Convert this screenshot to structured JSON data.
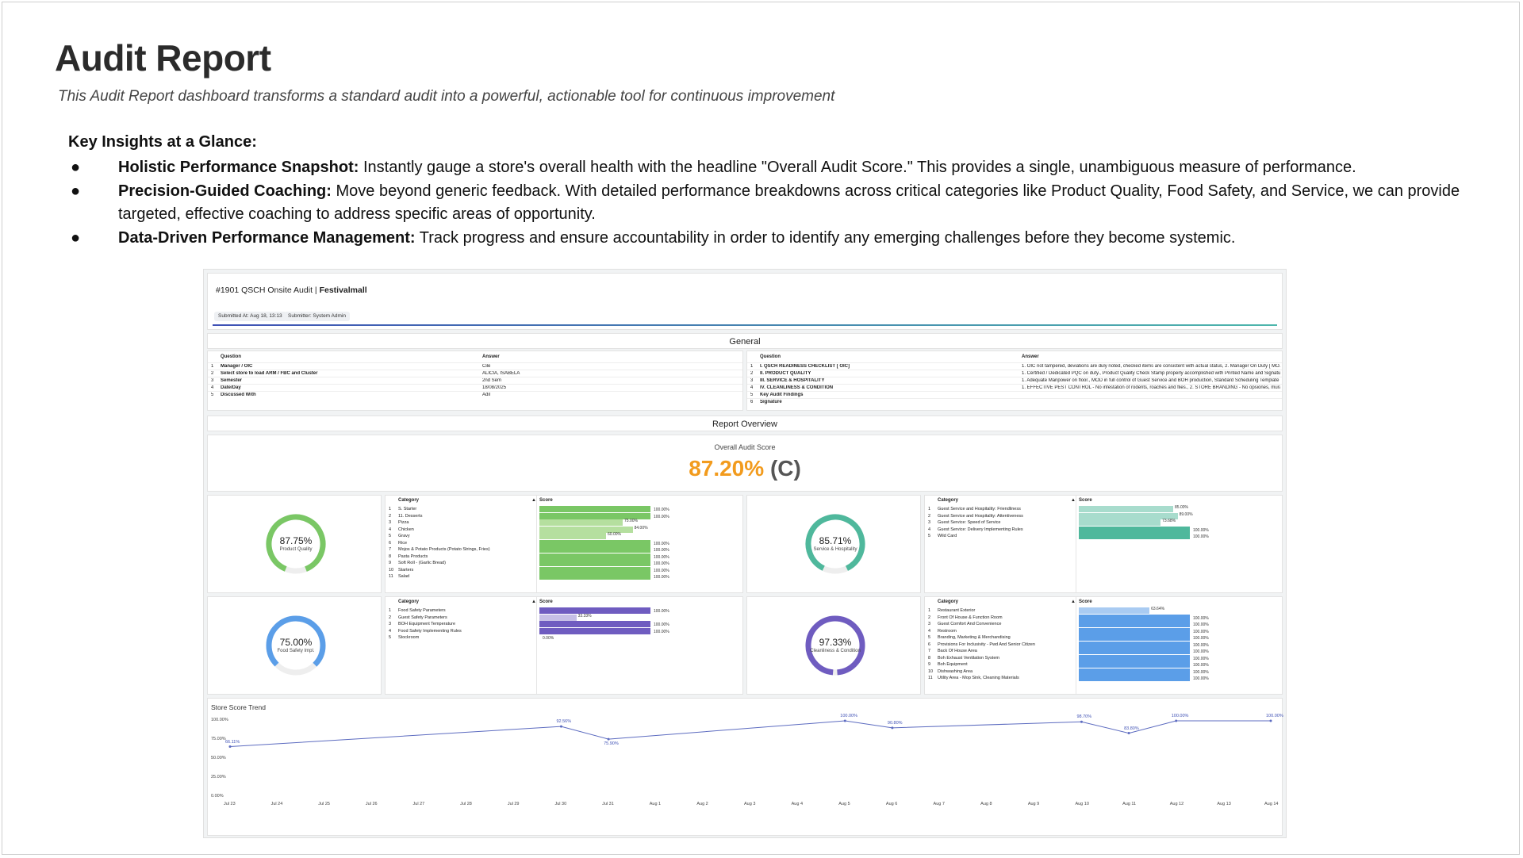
{
  "page": {
    "title": "Audit Report",
    "subtitle": "This Audit Report dashboard transforms a standard audit into a powerful, actionable tool for continuous improvement"
  },
  "insights": {
    "heading": "Key Insights at a Glance:",
    "items": [
      {
        "bold": "Holistic Performance Snapshot:",
        "text": " Instantly gauge a store's overall health with the headline \"Overall Audit Score.\" This provides a single, unambiguous measure of performance."
      },
      {
        "bold": "Precision-Guided Coaching:",
        "text": " Move beyond generic feedback. With detailed performance breakdowns across critical categories like Product Quality, Food Safety, and Service, we can provide targeted, effective coaching to address specific areas of opportunity."
      },
      {
        "bold": "Data-Driven Performance Management:",
        "text": " Track progress and ensure accountability in order to identify any emerging challenges before they become systemic."
      }
    ]
  },
  "dashboard": {
    "header_title": "#1901 QSCH Onsite Audit  |",
    "header_store": "Festivalmall",
    "submitted_at": "Submitted At: Aug 18, 13:13",
    "submitter": "Submitter: System Admin",
    "general_title": "General",
    "report_overview_title": "Report Overview",
    "general_left": {
      "col_question": "Question",
      "col_answer": "Answer",
      "rows": [
        {
          "n": "1",
          "q": "Manager / OIC",
          "a": "Cile"
        },
        {
          "n": "2",
          "q": "Select store to load ARM / FBC and Cluster",
          "a": "ALICIA, ISABELA"
        },
        {
          "n": "3",
          "q": "Semester",
          "a": "2nd Sem"
        },
        {
          "n": "4",
          "q": "Date/Day",
          "a": "18/08/2025"
        },
        {
          "n": "5",
          "q": "Discussed With",
          "a": "Adil"
        }
      ]
    },
    "general_right": {
      "col_question": "Question",
      "col_answer": "Answer",
      "rows": [
        {
          "n": "1",
          "q": "I. QSCH READINESS CHECKLIST [ OIC]",
          "a": "1. OIC not tampered, deviations are duly noted, checked items are consistent with actual status, 2. Manager On Duty [ MO..."
        },
        {
          "n": "2",
          "q": "II. PRODUCT QUALITY",
          "a": "1. Certified / Dedicated PQC on duty., Product Quality Check Stamp properly accomplished with Printed Name and Signatu..."
        },
        {
          "n": "3",
          "q": "III. SERVICE & HOSPITALITY",
          "a": "1. Adequate Manpower on floor., MOD in full control of Guest Service and BOH production, Standard Scheduling Template ..."
        },
        {
          "n": "4",
          "q": "IV. CLEANLINESS & CONDITION",
          "a": "1. EFFECTIVE PEST CONTROL - No infestation of rodents, roaches and flies., 2. STORE BRANDING - No opsiones, murals a..."
        },
        {
          "n": "5",
          "q": "Key Audit Findings",
          "a": ""
        },
        {
          "n": "6",
          "q": "Signature",
          "a": ""
        }
      ]
    },
    "overall": {
      "label": "Overall Audit Score",
      "value": "87.20%",
      "grade": "(C)"
    },
    "gauges": [
      {
        "id": "pq",
        "value": "87.75%",
        "label": "Product Quality",
        "fraction": 0.8775,
        "color": "#7ac765"
      },
      {
        "id": "sh",
        "value": "85.71%",
        "label": "Service & Hospitality",
        "fraction": 0.8571,
        "color": "#4fb89c"
      },
      {
        "id": "fs",
        "value": "75.00%",
        "label": "Food Safety Impl.",
        "fraction": 0.75,
        "color": "#5b9ee8"
      },
      {
        "id": "cc",
        "value": "97.33%",
        "label": "Cleanliness & Condition",
        "fraction": 0.9733,
        "color": "#6f5cc0"
      }
    ],
    "tables": [
      {
        "id": "pq",
        "col_category": "Category",
        "col_score": "Score",
        "color": "#7ac765",
        "light": "#b5df9f",
        "rows": [
          {
            "n": "1",
            "c": "S. Starter",
            "v": 100,
            "l": "100.00%"
          },
          {
            "n": "2",
            "c": "11. Desserts",
            "v": 100,
            "l": "100.00%"
          },
          {
            "n": "3",
            "c": "Pizza",
            "v": 75,
            "l": "75.00%"
          },
          {
            "n": "4",
            "c": "Chicken",
            "v": 84,
            "l": "84.00%"
          },
          {
            "n": "5",
            "c": "Gravy",
            "v": 60,
            "l": "60.00%"
          },
          {
            "n": "6",
            "c": "Rice",
            "v": 100,
            "l": "100.00%"
          },
          {
            "n": "7",
            "c": "Mojos & Potato Products (Potato Strings, Fries)",
            "v": 100,
            "l": "100.00%"
          },
          {
            "n": "8",
            "c": "Pasta Products",
            "v": 100,
            "l": "100.00%"
          },
          {
            "n": "9",
            "c": "Soft Roll - (Garlic Bread)",
            "v": 100,
            "l": "100.00%"
          },
          {
            "n": "10",
            "c": "Starters",
            "v": 100,
            "l": "100.00%"
          },
          {
            "n": "11",
            "c": "Salad",
            "v": 100,
            "l": "100.00%"
          }
        ]
      },
      {
        "id": "sh",
        "col_category": "Category",
        "col_score": "Score",
        "color": "#4fb89c",
        "light": "#a8dccd",
        "rows": [
          {
            "n": "1",
            "c": "Guest Service and Hospitality: Friendliness",
            "v": 85,
            "l": "85.00%"
          },
          {
            "n": "2",
            "c": "Guest Service and Hospitality: Attentiveness",
            "v": 89,
            "l": "89.00%"
          },
          {
            "n": "3",
            "c": "Guest Service: Speed of Service",
            "v": 73.68,
            "l": "73.68%"
          },
          {
            "n": "4",
            "c": "Guest Service: Delivery Implementing Rules",
            "v": 100,
            "l": "100.00%"
          },
          {
            "n": "5",
            "c": "Wild Card",
            "v": 100,
            "l": "100.00%"
          }
        ]
      },
      {
        "id": "fs",
        "col_category": "Category",
        "col_score": "Score",
        "color": "#6f5cc0",
        "light": "#c6bfe6",
        "rows": [
          {
            "n": "1",
            "c": "Food Safety Parameters",
            "v": 100,
            "l": "100.00%"
          },
          {
            "n": "2",
            "c": "Guest Safety Parameters",
            "v": 33.33,
            "l": "33.33%"
          },
          {
            "n": "3",
            "c": "BOH Equipment Temperature",
            "v": 100,
            "l": "100.00%"
          },
          {
            "n": "4",
            "c": "Food Safety Implementing Rules",
            "v": 100,
            "l": "100.00%"
          },
          {
            "n": "5",
            "c": "Stockroom",
            "v": 0,
            "l": "0.00%"
          }
        ]
      },
      {
        "id": "cc",
        "col_category": "Category",
        "col_score": "Score",
        "color": "#5b9ee8",
        "light": "#a9cbf2",
        "rows": [
          {
            "n": "1",
            "c": "Restaurant Exterior",
            "v": 63.64,
            "l": "63.64%"
          },
          {
            "n": "2",
            "c": "Front Of House & Function Room",
            "v": 100,
            "l": "100.00%"
          },
          {
            "n": "3",
            "c": "Guest Comfort And Convenience",
            "v": 100,
            "l": "100.00%"
          },
          {
            "n": "4",
            "c": "Restroom",
            "v": 100,
            "l": "100.00%"
          },
          {
            "n": "5",
            "c": "Branding, Marketing & Merchandising",
            "v": 100,
            "l": "100.00%"
          },
          {
            "n": "6",
            "c": "Provisions For Inclusivity - Pwd And Senior Citizen",
            "v": 100,
            "l": "100.00%"
          },
          {
            "n": "7",
            "c": "Back Of House Area",
            "v": 100,
            "l": "100.00%"
          },
          {
            "n": "8",
            "c": "Boh Exhaust Ventilation System",
            "v": 100,
            "l": "100.00%"
          },
          {
            "n": "9",
            "c": "Boh Equipment",
            "v": 100,
            "l": "100.00%"
          },
          {
            "n": "10",
            "c": "Dishwashing Area",
            "v": 100,
            "l": "100.00%"
          },
          {
            "n": "11",
            "c": "Utility Area - Mop Sink, Cleaning Materials",
            "v": 100,
            "l": "100.00%"
          }
        ]
      }
    ]
  },
  "chart_data": {
    "type": "line",
    "title": "Store Score Trend",
    "x": [
      "Jul 23",
      "Jul 24",
      "Jul 25",
      "Jul 26",
      "Jul 27",
      "Jul 28",
      "Jul 29",
      "Jul 30",
      "Jul 31",
      "Aug 1",
      "Aug 2",
      "Aug 3",
      "Aug 4",
      "Aug 5",
      "Aug 6",
      "Aug 7",
      "Aug 8",
      "Aug 9",
      "Aug 10",
      "Aug 11",
      "Aug 12",
      "Aug 13",
      "Aug 14"
    ],
    "series": [
      {
        "values": [
          66.11,
          null,
          null,
          null,
          null,
          null,
          null,
          92.56,
          75.9,
          null,
          null,
          null,
          null,
          100.0,
          90.8,
          null,
          null,
          null,
          98.7,
          83.8,
          100.0,
          null,
          100.0
        ]
      }
    ],
    "point_labels": [
      "66.11%",
      "92.56%",
      "75.90%",
      "100.00%",
      "90.80%",
      "98.70%",
      "83.80%",
      "100.00%",
      "100.00%"
    ],
    "yticks": [
      "100.00%",
      "75.00%",
      "50.00%",
      "25.00%",
      "0.00%"
    ],
    "ylim": [
      0,
      100
    ],
    "color": "#5c6bc0"
  }
}
